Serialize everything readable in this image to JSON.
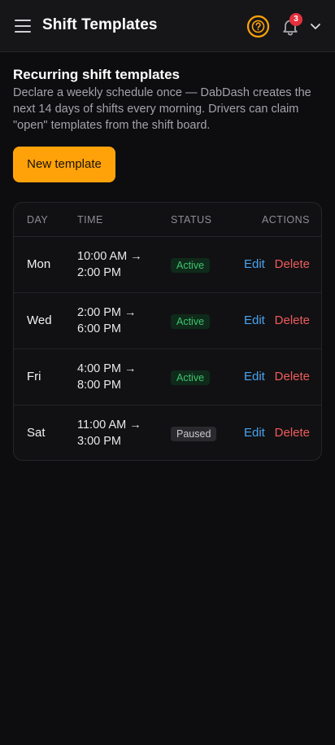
{
  "header": {
    "title": "Shift Templates",
    "notification_count": "3",
    "icons": {
      "menu": "hamburger-menu-icon",
      "help": "help-circle-icon",
      "notifications": "bell-icon",
      "account_menu": "chevron-down-icon"
    },
    "accent_color": "#ffa20a"
  },
  "intro": {
    "heading": "Recurring shift templates",
    "description": "Declare a weekly schedule once — DabDash creates the next 14 days of shifts every morning. Drivers can claim \"open\" templates from the shift board."
  },
  "actions": {
    "new_template_label": "New template"
  },
  "table": {
    "columns": [
      "DAY",
      "TIME",
      "STATUS",
      "ACTIONS"
    ],
    "rows": [
      {
        "day": "Mon",
        "time_start": "10:00 AM →",
        "time_end": "2:00 PM",
        "status": "Active",
        "edit": "Edit",
        "delete": "Delete"
      },
      {
        "day": "Wed",
        "time_start": "2:00 PM →",
        "time_end": "6:00 PM",
        "status": "Active",
        "edit": "Edit",
        "delete": "Delete"
      },
      {
        "day": "Fri",
        "time_start": "4:00 PM →",
        "time_end": "8:00 PM",
        "status": "Active",
        "edit": "Edit",
        "delete": "Delete"
      },
      {
        "day": "Sat",
        "time_start": "11:00 AM →",
        "time_end": "3:00 PM",
        "status": "Paused",
        "edit": "Edit",
        "delete": "Delete"
      }
    ]
  },
  "colors": {
    "status_active": "#3ec46d",
    "status_paused": "#c8c8cd",
    "edit_link": "#4aa3ef",
    "delete_link": "#ef5b5b",
    "badge": "#e5303e"
  }
}
